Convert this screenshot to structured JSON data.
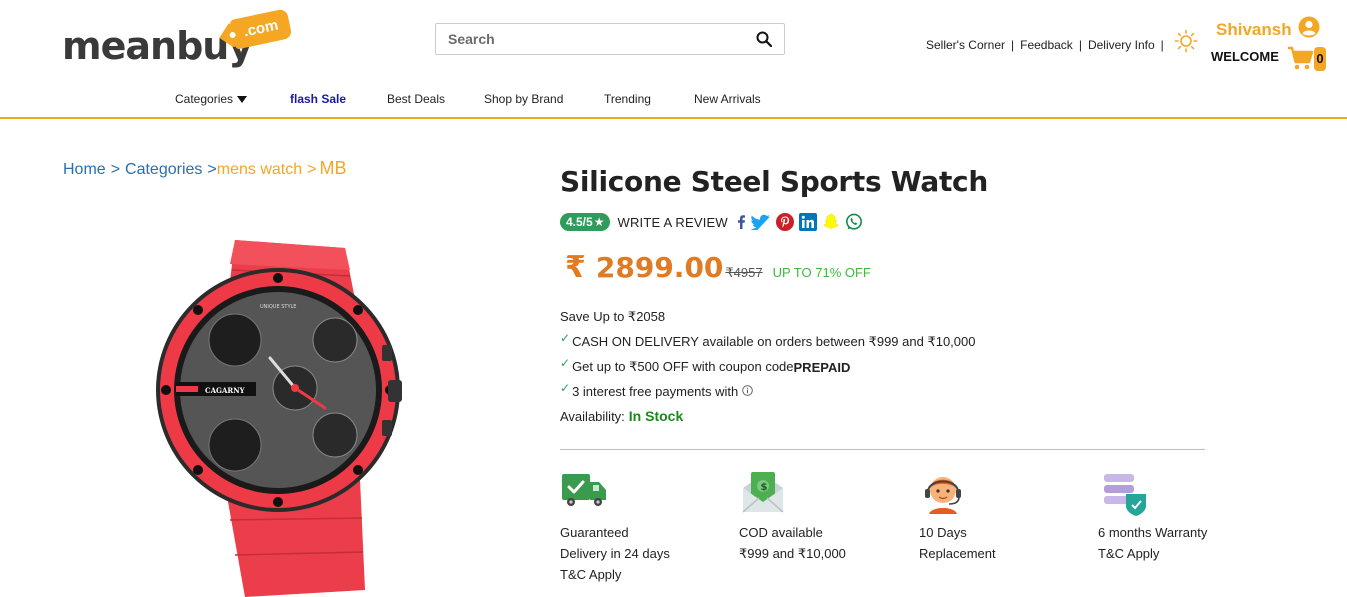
{
  "header": {
    "logo_text": "meanbuy",
    "logo_tag": ".com",
    "search_placeholder": "Search",
    "links": [
      "Seller's Corner",
      "Feedback",
      "Delivery Info"
    ],
    "user_name": "Shivansh",
    "welcome": "WELCOME",
    "cart_count": "0"
  },
  "nav": {
    "items": [
      "Categories",
      "flash Sale",
      "Best Deals",
      "Shop by Brand",
      "Trending",
      "New Arrivals"
    ]
  },
  "breadcrumb": {
    "home": "Home",
    "sep": ">",
    "categories": "Categories",
    "current": "mens watch",
    "last": "MB"
  },
  "product": {
    "title": "Silicone Steel Sports Watch",
    "rating": "4.5/5",
    "write_review": "WRITE A REVIEW",
    "currency_symbol": "₹",
    "price": "2899.00",
    "mrp": "₹4957",
    "off": "UP TO 71% OFF",
    "save": "Save Up to ₹2058",
    "offers": [
      {
        "text": "CASH ON DELIVERY available on orders between ₹999 and ₹10,000",
        "bold": ""
      },
      {
        "text": "Get up to ₹500 OFF with coupon code",
        "bold": "PREPAID"
      },
      {
        "text": "3 interest free payments with",
        "bold": ""
      }
    ],
    "availability_label": "Availability:",
    "availability_value": "In Stock"
  },
  "features": [
    {
      "icon": "delivery-truck-icon",
      "text": "Guaranteed Delivery in 24 days T&C Apply"
    },
    {
      "icon": "cash-envelope-icon",
      "text": "COD available ₹999 and ₹10,000"
    },
    {
      "icon": "support-agent-icon",
      "text": "10 Days Replacement"
    },
    {
      "icon": "warranty-shield-icon",
      "text": "6 months Warranty T&C Apply"
    }
  ],
  "colors": {
    "accent": "#f5a623",
    "price": "#e07b24",
    "link": "#2a6fb0",
    "in_stock": "#1a8a1a",
    "rating_badge": "#2e9c5a"
  }
}
